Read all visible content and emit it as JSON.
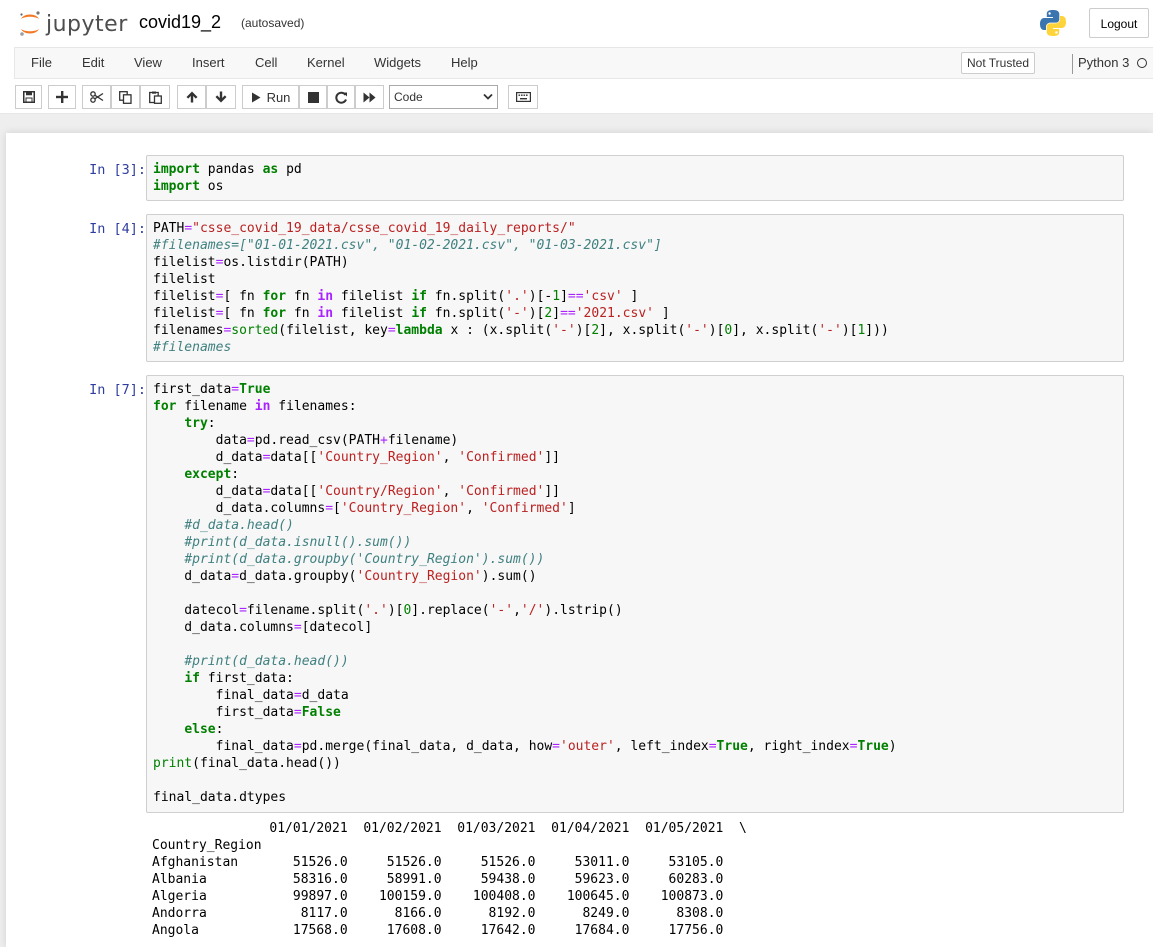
{
  "header": {
    "logo_text": "jupyter",
    "notebook_name": "covid19_2",
    "save_status": "(autosaved)",
    "logout_label": "Logout"
  },
  "menubar": {
    "items": [
      "File",
      "Edit",
      "View",
      "Insert",
      "Cell",
      "Kernel",
      "Widgets",
      "Help"
    ],
    "trust_label": "Not Trusted",
    "kernel_name": "Python 3"
  },
  "toolbar": {
    "run_label": "Run",
    "cell_type": "Code"
  },
  "cells": [
    {
      "prompt": "In [3]:",
      "code": "import pandas as pd\nimport os"
    },
    {
      "prompt": "In [4]:",
      "code": "PATH=\"csse_covid_19_data/csse_covid_19_daily_reports/\"\n#filenames=[\"01-01-2021.csv\", \"01-02-2021.csv\", \"01-03-2021.csv\"]\nfilelist=os.listdir(PATH)\nfilelist\nfilelist=[ fn for fn in filelist if fn.split('.')[-1]=='csv' ]\nfilelist=[ fn for fn in filelist if fn.split('-')[2]=='2021.csv' ]\nfilenames=sorted(filelist, key=lambda x : (x.split('-')[2], x.split('-')[0], x.split('-')[1]))\n#filenames"
    },
    {
      "prompt": "In [7]:",
      "code": "first_data=True\nfor filename in filenames:\n    try:\n        data=pd.read_csv(PATH+filename)\n        d_data=data[['Country_Region', 'Confirmed']]\n    except:\n        d_data=data[['Country/Region', 'Confirmed']]\n        d_data.columns=['Country_Region', 'Confirmed']\n    #d_data.head()\n    #print(d_data.isnull().sum())\n    #print(d_data.groupby('Country_Region').sum())\n    d_data=d_data.groupby('Country_Region').sum()\n\n    datecol=filename.split('.')[0].replace('-','/').lstrip()\n    d_data.columns=[datecol]\n\n    #print(d_data.head())\n    if first_data:\n        final_data=d_data\n        first_data=False\n    else:\n        final_data=pd.merge(final_data, d_data, how='outer', left_index=True, right_index=True)\nprint(final_data.head())\n\nfinal_data.dtypes",
      "output": "               01/01/2021  01/02/2021  01/03/2021  01/04/2021  01/05/2021  \\\nCountry_Region\nAfghanistan       51526.0     51526.0     51526.0     53011.0     53105.0\nAlbania           58316.0     58991.0     59438.0     59623.0     60283.0\nAlgeria           99897.0    100159.0    100408.0    100645.0    100873.0\nAndorra            8117.0      8166.0      8192.0      8249.0      8308.0\nAngola            17568.0     17608.0     17642.0     17684.0     17756.0"
    }
  ],
  "colors": {
    "prompt": "#303f9f",
    "keyword": "#008000",
    "string": "#ba2121",
    "comment": "#408080",
    "operator": "#aa22ff",
    "logo_orange": "#f37726"
  }
}
